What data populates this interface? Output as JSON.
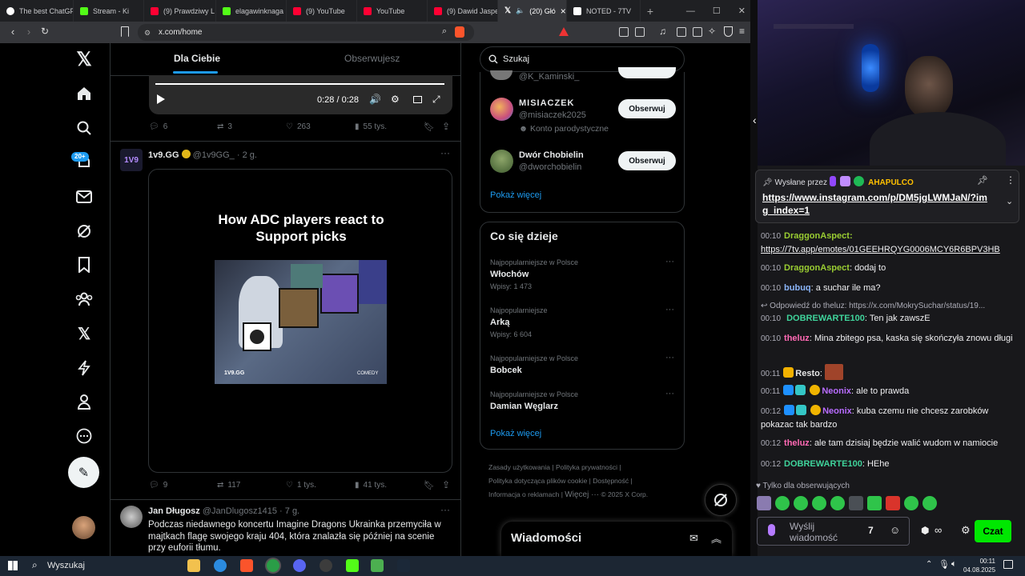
{
  "tabs": [
    {
      "label": "The best ChatGP",
      "color": "#ffffff"
    },
    {
      "label": "Stream - Ki",
      "color": "#53fc18"
    },
    {
      "label": "(9) Prawdziwy L",
      "color": "#ff0033"
    },
    {
      "label": "elagawinknaga",
      "color": "#53fc18"
    },
    {
      "label": "(9) YouTube",
      "color": "#ff0033"
    },
    {
      "label": "YouTube",
      "color": "#ff0033"
    },
    {
      "label": "(9) Dawid Jaspe",
      "color": "#ff0033"
    },
    {
      "label": "(20) Głó",
      "color": "#ffffff"
    },
    {
      "label": "NOTED - 7TV",
      "color": "#ffffff"
    }
  ],
  "browser": {
    "url": "x.com/home",
    "new_tab": "+",
    "close": "×"
  },
  "feed": {
    "tab_for_you": "Dla Ciebie",
    "tab_following": "Obserwujesz",
    "video_time": "0:28 / 0:28",
    "post1_actions": {
      "replies": "6",
      "reposts": "3",
      "likes": "263",
      "views": "55 tys."
    },
    "post2": {
      "author": "1v9.GG",
      "handle": "@1v9GG_",
      "time": "· 2 g.",
      "image_title": "How ADC players react to Support picks",
      "image_brand": "1V9.GG",
      "image_corner": "COMEDY",
      "replies": "9",
      "reposts": "117",
      "likes": "1 tys.",
      "views": "41 tys."
    },
    "post3": {
      "author": "Jan Długosz",
      "handle": "@JanDlugosz1415",
      "time": "· 7 g.",
      "text": "Podczas niedawnego koncertu Imagine Dragons Ukrainka przemyciła w majtkach flagę swojego kraju 404, która znalazła się później na scenie przy euforii tłumu."
    }
  },
  "sidebar": {
    "notif_badge": "20+"
  },
  "right": {
    "search_placeholder": "Szukaj",
    "follow_partial_handle": "@K_Kaminski_",
    "who": [
      {
        "name": "MISIACZEK",
        "handle": "@misiaczek2025",
        "note": "Konto parodystyczne",
        "btn": "Obserwuj"
      },
      {
        "name": "Dwór Chobielin",
        "handle": "@dworchobielin",
        "btn": "Obserwuj"
      }
    ],
    "show_more": "Pokaż więcej",
    "trends_title": "Co się dzieje",
    "trends": [
      {
        "ctx": "Najpopularniejsze w Polsce",
        "name": "Włochów",
        "count": "Wpisy: 1 473"
      },
      {
        "ctx": "Najpopularniejsze",
        "name": "Arką",
        "count": "Wpisy: 6 604"
      },
      {
        "ctx": "Najpopularniejsze w Polsce",
        "name": "Bobcek",
        "count": ""
      },
      {
        "ctx": "Najpopularniejsze w Polsce",
        "name": "Damian Węglarz",
        "count": ""
      }
    ],
    "show_more2": "Pokaż więcej",
    "footer": [
      "Zasady użytkowania",
      "Polityka prywatności",
      "Polityka dotycząca plików cookie",
      "Dostępność",
      "Informacja o reklamach",
      "Więcej ···",
      "© 2025 X Corp."
    ],
    "messages": "Wiadomości"
  },
  "stream": {
    "pinned_by": "Wysłane przez",
    "pinned_user": "AHAPULCO",
    "pinned_link": "https://www.instagram.com/p/DM5jgLWMJaN/?img_index=1",
    "messages": [
      {
        "time": "00:10",
        "user": "DraggonAspect",
        "color": "#9acd32",
        "text": "https://7tv.app/emotes/01GEEHRQYG0006MCY6R6BPV3HB"
      },
      {
        "time": "00:10",
        "user": "DraggonAspect",
        "color": "#9acd32",
        "text": "dodaj to"
      },
      {
        "time": "00:10",
        "user": "bubuq",
        "color": "#8ab4f8",
        "text": "a suchar ile ma?"
      },
      {
        "time": "00:10",
        "user": "DOBREWARTE100",
        "color": "#3fd39b",
        "text": "Ten jak zawszE",
        "reply": "Odpowiedź do theluz: https://x.com/MokrySuchar/status/19..."
      },
      {
        "time": "00:10",
        "user": "theluz",
        "color": "#ff69b4",
        "text": "Mina zbitego psa, kaska się skończyła znowu długi"
      },
      {
        "time": "00:11",
        "user": "Resto",
        "color": "#e6e6e6",
        "text": ""
      },
      {
        "time": "00:11",
        "user": "Neonix",
        "color": "#b86cff",
        "text": "ale to prawda"
      },
      {
        "time": "00:12",
        "user": "Neonix",
        "color": "#b86cff",
        "text": "kuba czemu nie chcesz zarobków pokazac tak bardzo"
      },
      {
        "time": "00:12",
        "user": "theluz",
        "color": "#ff69b4",
        "text": "ale tam dzisiaj będzie walić wudom w namiocie"
      },
      {
        "time": "00:12",
        "user": "DOBREWARTE100",
        "color": "#3fd39b",
        "text": "HEhe"
      }
    ],
    "followers_only": "Tylko dla obserwujących",
    "input_placeholder": "Wyślij wiadomość",
    "send": "Czat"
  },
  "taskbar": {
    "search": "Wyszukaj",
    "time": "00:11",
    "date": "04.08.2025"
  }
}
